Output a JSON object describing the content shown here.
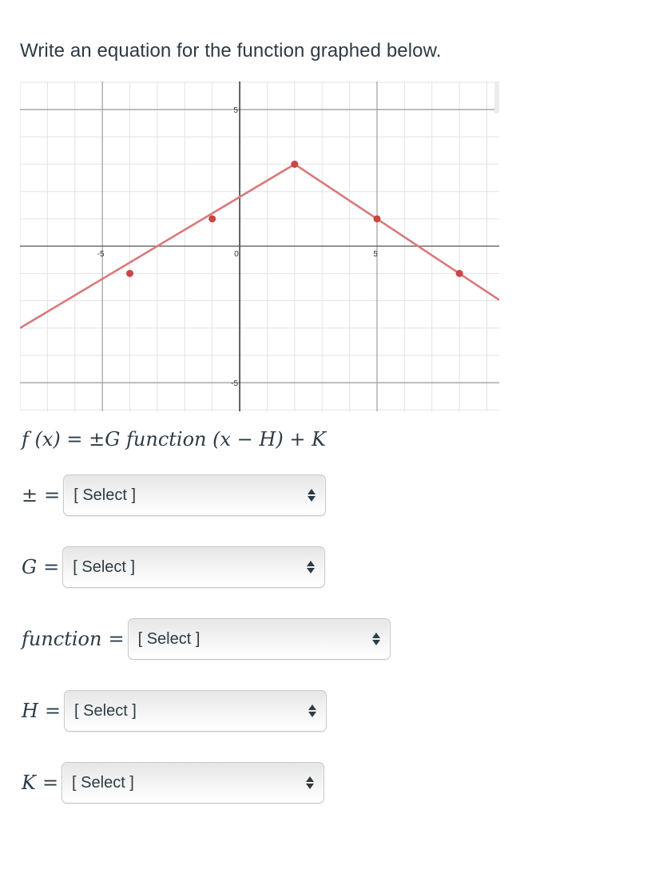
{
  "prompt": "Write an equation for the function graphed below.",
  "graph": {
    "axis_tick_labels": {
      "x": [
        "-5",
        "0",
        "5"
      ],
      "y": [
        "5",
        "-5"
      ]
    },
    "line_color": "#d9797a",
    "point_color": "#cc4444"
  },
  "chart_data": {
    "type": "line",
    "title": "",
    "xlabel": "",
    "ylabel": "",
    "xlim": [
      -8,
      9.45
    ],
    "ylim": [
      -6.05,
      6.03
    ],
    "grid": true,
    "x_ticks_labeled": [
      -5,
      0,
      5
    ],
    "y_ticks_labeled": [
      -5,
      5
    ],
    "series": [
      {
        "name": "f(x)",
        "line": [
          [
            -8,
            -3
          ],
          [
            2,
            3
          ],
          [
            9.45,
            -1.97
          ]
        ],
        "points": [
          [
            -4,
            -1
          ],
          [
            -1,
            1
          ],
          [
            2,
            3
          ],
          [
            5,
            1
          ],
          [
            8,
            -1
          ]
        ]
      }
    ]
  },
  "formula": {
    "lhs": "f (x) = ",
    "pm": "±",
    "rest": "G function (x − H) + K"
  },
  "fields": [
    {
      "var": "±",
      "label": "[ Select ]"
    },
    {
      "var": "G",
      "label": "[ Select ]"
    },
    {
      "var": "function",
      "label": "[ Select ]"
    },
    {
      "var": "H",
      "label": "[ Select ]"
    },
    {
      "var": "K",
      "label": "[ Select ]"
    }
  ]
}
